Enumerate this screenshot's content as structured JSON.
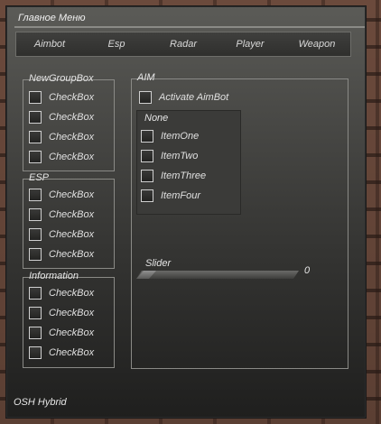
{
  "window": {
    "title": "Главное Меню",
    "footer": "OSH Hybrid"
  },
  "tabs": [
    {
      "label": "Aimbot"
    },
    {
      "label": "Esp"
    },
    {
      "label": "Radar"
    },
    {
      "label": "Player"
    },
    {
      "label": "Weapon"
    }
  ],
  "groups": [
    {
      "title": "NewGroupBox",
      "items": [
        "CheckBox",
        "CheckBox",
        "CheckBox",
        "CheckBox"
      ]
    },
    {
      "title": "ESP",
      "items": [
        "CheckBox",
        "CheckBox",
        "CheckBox",
        "CheckBox"
      ]
    },
    {
      "title": "Information",
      "items": [
        "CheckBox",
        "CheckBox",
        "CheckBox",
        "CheckBox"
      ]
    }
  ],
  "aim": {
    "title": "AIM",
    "activate_label": "Activate AimBot",
    "dropdown": {
      "selected": "None",
      "items": [
        "ItemOne",
        "ItemTwo",
        "ItemThree",
        "ItemFour"
      ]
    },
    "slider": {
      "label": "Slider",
      "value": "0"
    }
  }
}
